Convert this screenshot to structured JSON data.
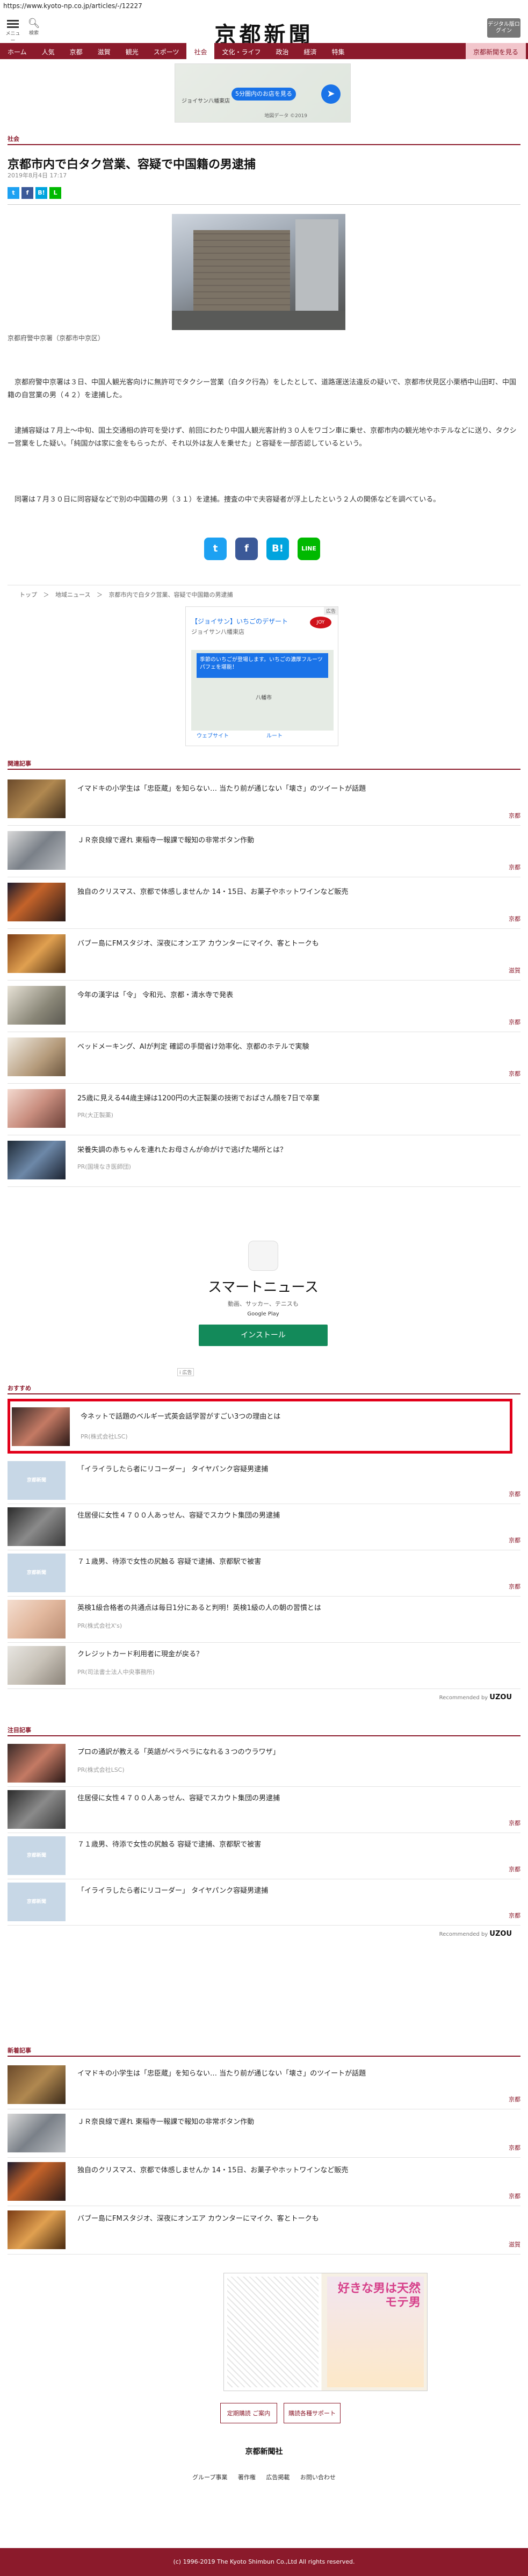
{
  "url": "https://www.kyoto-np.co.jp/articles/-/12227",
  "header": {
    "menu_label": "メニュー",
    "search_label": "検索",
    "logo": "京都新聞",
    "digital_label": "デジタル版ログイン"
  },
  "nav": {
    "items": [
      "ホーム",
      "人気",
      "京都",
      "滋賀",
      "観光",
      "スポーツ",
      "社会",
      "文化・ライフ",
      "政治",
      "経済",
      "特集",
      "京都新聞を見る"
    ]
  },
  "ad_top": {
    "pill": "5分圏内のお店を見る",
    "store": "ジョイサン八幡東店",
    "note": "地図データ ©2019"
  },
  "article": {
    "section": "社会",
    "title": "京都市内で白タク営業、容疑で中国籍の男逮捕",
    "date": "2019年8月4日 17:17",
    "caption": "京都府警中京署（京都市中京区）",
    "paragraphs": [
      "京都府警中京署は３日、中国人観光客向けに無許可でタクシー営業（白タク行為）をしたとして、道路運送法違反の疑いで、京都市伏見区小栗栖中山田町、中国籍の自営業の男（４２）を逮捕した。",
      "逮捕容疑は７月上～中旬、国土交通相の許可を受けず、前回にわたり中国人観光客計約３０人をワゴン車に乗せ、京都市内の観光地やホテルなどに送り、タクシー営業をした疑い。「純国かは家に金をもらったが、それ以外は友人を乗せた」と容疑を一部否認しているという。",
      "同署は７月３０日に同容疑などで別の中国籍の男（３１）を逮捕。捜査の中で夫容疑者が浮上したという２人の関係などを調べている。"
    ],
    "share_small": [
      "t",
      "f",
      "B!",
      "L"
    ],
    "share_big": [
      "t",
      "f",
      "B!",
      "LINE"
    ]
  },
  "breadcrumb": [
    "トップ",
    "＞",
    "地域ニュース",
    "＞",
    "京都市内で白タク営業、容疑で中国籍の男逮捕"
  ],
  "ad_mid": {
    "head": "【ジョイサン】いちごのデザート",
    "sub": "ジョイサン八幡東店",
    "blue_text": "季節のいちごが登場します。いちごの濃厚フルーツパフェを堪能！",
    "loc": "八幡市",
    "btn1": "ウェブサイト",
    "btn2": "ルート",
    "tag": "広告"
  },
  "related": {
    "heading": "関連記事",
    "items": [
      {
        "title": "イマドキの小学生は「忠臣蔵」を知らない… 当たり前が通じない「壊さ」のツイートが話題",
        "src": "京都"
      },
      {
        "title": "ＪＲ奈良線で遅れ 東稲寺一報課で報知の非常ボタン作動",
        "src": "京都"
      },
      {
        "title": "独自のクリスマス、京都で体感しませんか 14・15日、お菓子やホットワインなど販売",
        "src": "京都"
      },
      {
        "title": "バブー島にFMスタジオ、深夜にオンエア カウンターにマイク、客とトークも",
        "src": "滋賀"
      },
      {
        "title": "今年の漢字は「令」 令和元、京都・清水寺で発表",
        "src": "京都"
      },
      {
        "title": "ベッドメーキング、AIが判定 確認の手間省け効率化、京都のホテルで実験",
        "src": "京都"
      },
      {
        "title": "25歳に見える44歳主婦は1200円の大正製薬の技術でおばさん顔を7日で卒業",
        "src": "PR(大正製薬)"
      },
      {
        "title": "栄養失調の赤ちゃんを連れたお母さんが命がけで逃げた場所とは？",
        "src": "PR(国境なき医師団)"
      }
    ]
  },
  "app_ad": {
    "name": "スマートニュース",
    "sub": "動画、サッカー、テニスも",
    "store": "Google Play",
    "button": "インストール",
    "tag": "i 広告"
  },
  "recommend": {
    "heading": "おすすめ",
    "items": [
      {
        "title": "今ネットで話題のベルギー式英会話学習がすごい3つの理由とは",
        "src": "PR(株式会社LSC)"
      },
      {
        "title": "「イライラしたら者にリコーダー」 タイヤパンク容疑男逮捕",
        "src": "京都"
      },
      {
        "title": "住居侵に女性４７００人あっせん、容疑でスカウト集団の男逮捕",
        "src": "京都"
      },
      {
        "title": "７１歳男、待添で女性の尻触る 容疑で逮捕、京都駅で被害",
        "src": "京都"
      },
      {
        "title": "英検1級合格者の共通点は毎日1分にあると判明！英検1級の人の朝の習慣とは",
        "src": "PR(株式会社X's)"
      },
      {
        "title": "クレジットカード利用者に現金が戻る？",
        "src": "PR(司法書士法人中央事務所)"
      }
    ],
    "recommended_by": "Recommended by",
    "uzou": "UZOU"
  },
  "noted": {
    "heading": "注目記事",
    "items": [
      {
        "title": "プロの通訳が教える「英語がペラペラになれる３つのウラワザ」",
        "src": "PR(株式会社LSC)"
      },
      {
        "title": "住居侵に女性４７００人あっせん、容疑でスカウト集団の男逮捕",
        "src": "京都"
      },
      {
        "title": "７１歳男、待添で女性の尻触る 容疑で逮捕、京都駅で被害",
        "src": "京都"
      },
      {
        "title": "「イライラしたら者にリコーダー」 タイヤパンク容疑男逮捕",
        "src": "京都"
      }
    ]
  },
  "latest": {
    "heading": "新着記事",
    "items": [
      {
        "title": "イマドキの小学生は「忠臣蔵」を知らない… 当たり前が通じない「壊さ」のツイートが話題",
        "src": "京都"
      },
      {
        "title": "ＪＲ奈良線で遅れ 東稲寺一報課で報知の非常ボタン作動",
        "src": "京都"
      },
      {
        "title": "独自のクリスマス、京都で体感しませんか 14・15日、お菓子やホットワインなど販売",
        "src": "京都"
      },
      {
        "title": "バブー島にFMスタジオ、深夜にオンエア カウンターにマイク、客とトークも",
        "src": "滋賀"
      }
    ]
  },
  "manga": {
    "text": "好きな男は天然モテ男"
  },
  "footer": {
    "btn1": "定期購読 ご案内",
    "btn2": "購読各種サポート",
    "logo": "京都新聞社",
    "links": [
      "グループ事業",
      "著作権",
      "広告掲載",
      "お問い合わせ"
    ],
    "copyright": "(c) 1996-2019 The Kyoto Shimbun Co.,Ltd All rights reserved."
  }
}
